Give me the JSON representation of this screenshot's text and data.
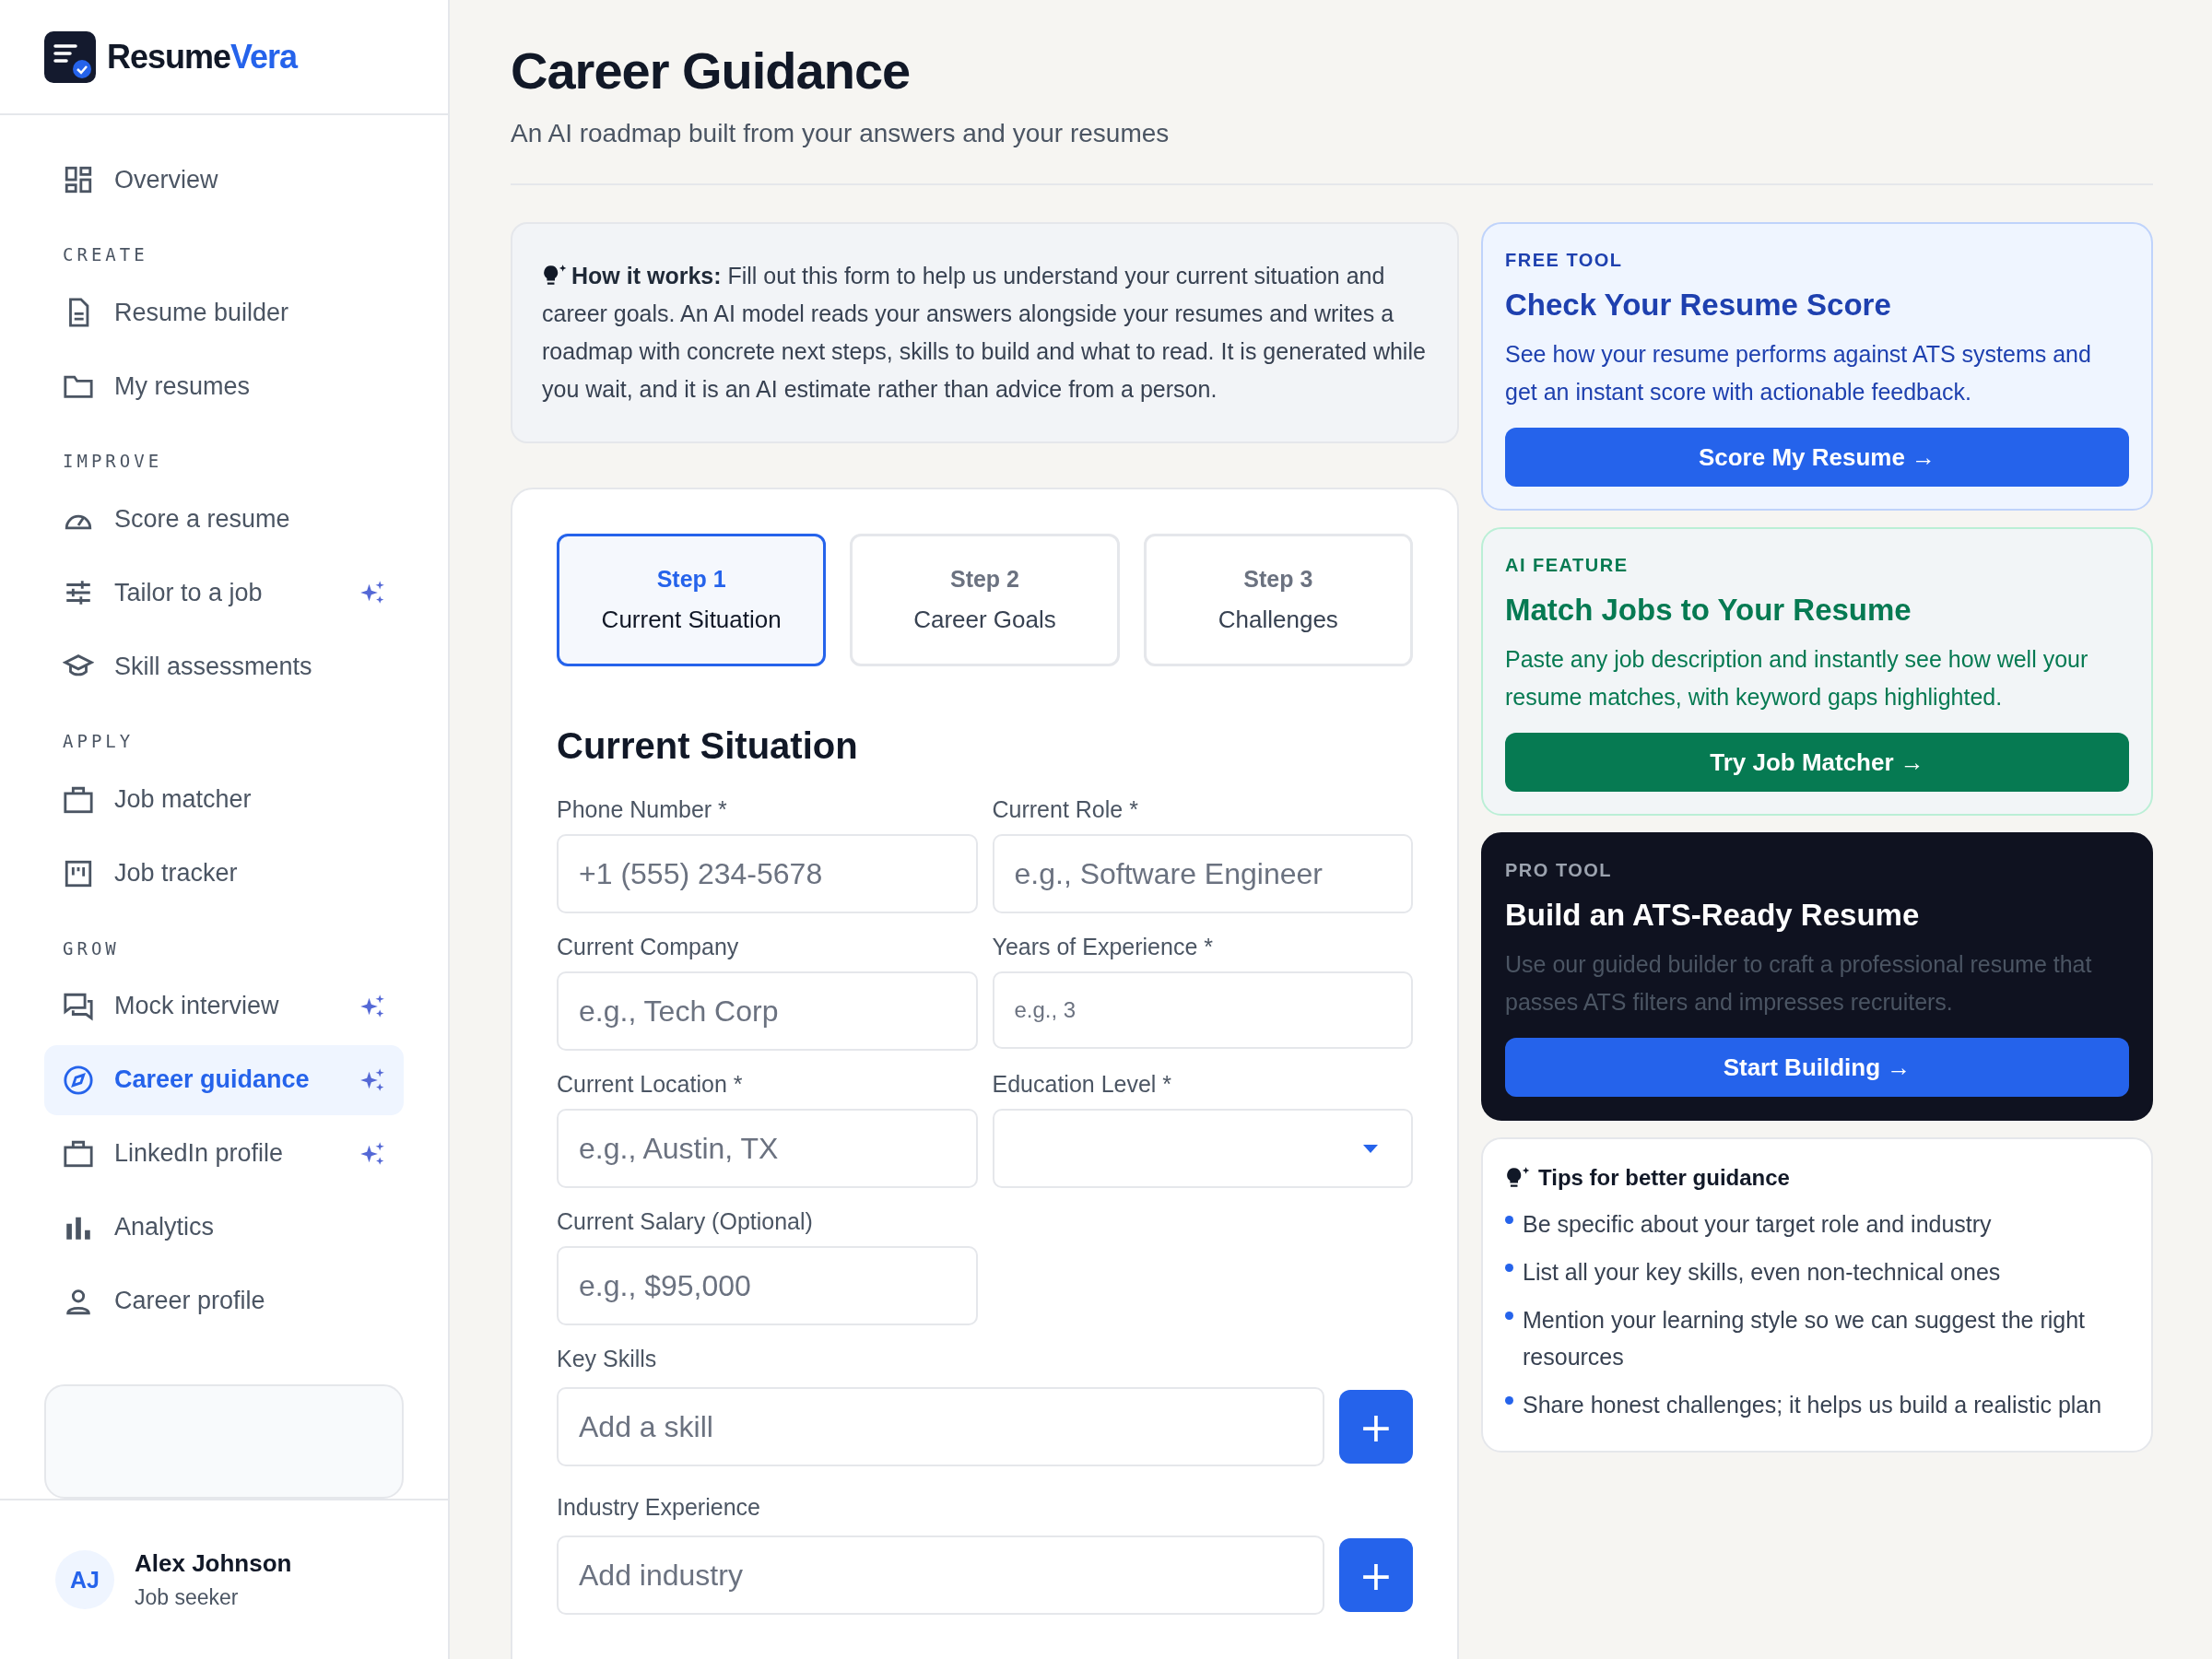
{
  "brand": {
    "name_part_1": "Resume",
    "name_part_2": "Vera"
  },
  "sidebar": {
    "items": [
      {
        "kind": "item",
        "label": "Overview",
        "selected": false,
        "ai_badge": false
      },
      {
        "kind": "section",
        "label": "CREATE"
      },
      {
        "kind": "item",
        "label": "Resume builder",
        "selected": false,
        "ai_badge": false
      },
      {
        "kind": "item",
        "label": "My resumes",
        "selected": false,
        "ai_badge": false
      },
      {
        "kind": "section",
        "label": "IMPROVE"
      },
      {
        "kind": "item",
        "label": "Score a resume",
        "selected": false,
        "ai_badge": false
      },
      {
        "kind": "item",
        "label": "Tailor to a job",
        "selected": false,
        "ai_badge": true
      },
      {
        "kind": "item",
        "label": "Skill assessments",
        "selected": false,
        "ai_badge": false
      },
      {
        "kind": "section",
        "label": "APPLY"
      },
      {
        "kind": "item",
        "label": "Job matcher",
        "selected": false,
        "ai_badge": false
      },
      {
        "kind": "item",
        "label": "Job tracker",
        "selected": false,
        "ai_badge": false
      },
      {
        "kind": "section",
        "label": "GROW"
      },
      {
        "kind": "item",
        "label": "Mock interview",
        "selected": false,
        "ai_badge": true
      },
      {
        "kind": "item",
        "label": "Career guidance",
        "selected": true,
        "ai_badge": true
      },
      {
        "kind": "item",
        "label": "LinkedIn profile",
        "selected": false,
        "ai_badge": true
      },
      {
        "kind": "item",
        "label": "Analytics",
        "selected": false,
        "ai_badge": false
      },
      {
        "kind": "item",
        "label": "Career profile",
        "selected": false,
        "ai_badge": false
      }
    ],
    "user": {
      "initials": "AJ",
      "name": "Alex Johnson",
      "role": "Job seeker"
    }
  },
  "page": {
    "title": "Career Guidance",
    "subtitle": "An AI roadmap built from your answers and your resumes"
  },
  "info": {
    "text": "**How it works:** Fill out this form to help us understand your current situation and career goals. An AI model reads your answers alongside your resumes and writes a roadmap with concrete next steps, skills to build and what to read. It is generated while you wait, and it is an AI estimate rather than advice from a person."
  },
  "steps": [
    {
      "step": "Step 1",
      "label": "Current Situation",
      "selected": true
    },
    {
      "step": "Step 2",
      "label": "Career Goals",
      "selected": false
    },
    {
      "step": "Step 3",
      "label": "Challenges",
      "selected": false
    }
  ],
  "form": {
    "heading": "Current Situation",
    "fields": [
      {
        "kind": "text",
        "label": "Phone Number",
        "asterisk": "*",
        "placeholder": "+1 (555) 234-5678"
      },
      {
        "kind": "text",
        "label": "Current Role",
        "asterisk": "*",
        "placeholder": "e.g., Software Engineer"
      },
      {
        "kind": "text",
        "label": "Current Company",
        "placeholder": "e.g., Tech Corp"
      },
      {
        "kind": "small",
        "label": "Years of Experience",
        "asterisk": "*",
        "placeholder": "e.g., 3"
      },
      {
        "kind": "text",
        "label": "Current Location",
        "asterisk": "*",
        "placeholder": "e.g., Austin, TX"
      },
      {
        "kind": "select",
        "label": "Education Level",
        "asterisk": "*"
      },
      {
        "kind": "text",
        "label": "Current Salary (Optional)",
        "placeholder": "e.g., $95,000"
      },
      {
        "kind": "adder",
        "label": "Key Skills",
        "placeholder": "Add a skill",
        "button": "+"
      },
      {
        "kind": "adder",
        "label": "Industry Experience",
        "placeholder": "Add industry",
        "button": "+"
      }
    ]
  },
  "promos": [
    {
      "kind": "free",
      "tag": "FREE TOOL",
      "title": "Check Your Resume Score",
      "text": "See how your resume performs against ATS systems and get an instant score with actionable feedback.",
      "button": "Score My Resume →"
    },
    {
      "kind": "ai",
      "tag": "AI FEATURE",
      "title": "Match Jobs to Your Resume",
      "text": "Paste any job description and instantly see how well your resume matches, with keyword gaps highlighted.",
      "button": "Try Job Matcher →"
    },
    {
      "kind": "pro",
      "tag": "PRO TOOL",
      "title": "Build an ATS-Ready Resume",
      "text": "Use our guided builder to craft a professional resume that passes ATS filters and impresses recruiters.",
      "button": "Start Building →"
    }
  ],
  "tips": {
    "title": "Tips for better guidance",
    "items": [
      "Be specific about your target role and industry",
      "List all your key skills, even non-technical ones",
      "Mention your learning style so we can suggest the right resources",
      "Share honest challenges; it helps us build a realistic plan"
    ]
  }
}
